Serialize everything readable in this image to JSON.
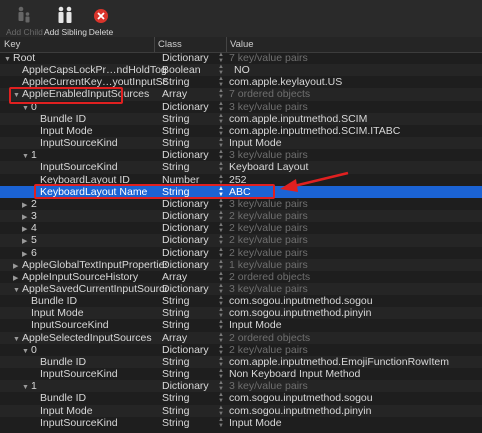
{
  "toolbar": {
    "add_child": "Add Child",
    "add_sibling": "Add Sibling",
    "delete": "Delete"
  },
  "columns": {
    "key": "Key",
    "class": "Class",
    "value": "Value"
  },
  "rows": [
    {
      "indent": 0,
      "tri": "down",
      "key": "Root",
      "type": "Dictionary",
      "value": "7 key/value pairs",
      "dim": true
    },
    {
      "indent": 1,
      "tri": "",
      "key": "AppleCapsLockPr…ndHoldToggleOff",
      "type": "Boolean",
      "value": "NO",
      "dim": false
    },
    {
      "indent": 1,
      "tri": "",
      "key": "AppleCurrentKey…youtInputSourceID",
      "type": "String",
      "value": "com.apple.keylayout.US",
      "dim": false
    },
    {
      "indent": 1,
      "tri": "down",
      "key": "AppleEnabledInputSources",
      "type": "Array",
      "value": "7 ordered objects",
      "dim": true
    },
    {
      "indent": 2,
      "tri": "down",
      "key": "0",
      "type": "Dictionary",
      "value": "3 key/value pairs",
      "dim": true
    },
    {
      "indent": 3,
      "tri": "",
      "key": "Bundle ID",
      "type": "String",
      "value": "com.apple.inputmethod.SCIM",
      "dim": false
    },
    {
      "indent": 3,
      "tri": "",
      "key": "Input Mode",
      "type": "String",
      "value": "com.apple.inputmethod.SCIM.ITABC",
      "dim": false
    },
    {
      "indent": 3,
      "tri": "",
      "key": "InputSourceKind",
      "type": "String",
      "value": "Input Mode",
      "dim": false
    },
    {
      "indent": 2,
      "tri": "down",
      "key": "1",
      "type": "Dictionary",
      "value": "3 key/value pairs",
      "dim": true
    },
    {
      "indent": 3,
      "tri": "",
      "key": "InputSourceKind",
      "type": "String",
      "value": "Keyboard Layout",
      "dim": false
    },
    {
      "indent": 3,
      "tri": "",
      "key": "KeyboardLayout ID",
      "type": "Number",
      "value": "252",
      "dim": false
    },
    {
      "indent": 3,
      "tri": "",
      "key": "KeyboardLayout Name",
      "type": "String",
      "value": "ABC",
      "dim": false,
      "selected": true
    },
    {
      "indent": 2,
      "tri": "right",
      "key": "2",
      "type": "Dictionary",
      "value": "3 key/value pairs",
      "dim": true
    },
    {
      "indent": 2,
      "tri": "right",
      "key": "3",
      "type": "Dictionary",
      "value": "2 key/value pairs",
      "dim": true
    },
    {
      "indent": 2,
      "tri": "right",
      "key": "4",
      "type": "Dictionary",
      "value": "2 key/value pairs",
      "dim": true
    },
    {
      "indent": 2,
      "tri": "right",
      "key": "5",
      "type": "Dictionary",
      "value": "2 key/value pairs",
      "dim": true
    },
    {
      "indent": 2,
      "tri": "right",
      "key": "6",
      "type": "Dictionary",
      "value": "2 key/value pairs",
      "dim": true
    },
    {
      "indent": 1,
      "tri": "right",
      "key": "AppleGlobalTextInputProperties",
      "type": "Dictionary",
      "value": "1 key/value pairs",
      "dim": true
    },
    {
      "indent": 1,
      "tri": "right",
      "key": "AppleInputSourceHistory",
      "type": "Array",
      "value": "2 ordered objects",
      "dim": true
    },
    {
      "indent": 1,
      "tri": "down",
      "key": "AppleSavedCurrentInputSource",
      "type": "Dictionary",
      "value": "3 key/value pairs",
      "dim": true
    },
    {
      "indent": 2,
      "tri": "",
      "key": "Bundle ID",
      "type": "String",
      "value": "com.sogou.inputmethod.sogou",
      "dim": false
    },
    {
      "indent": 2,
      "tri": "",
      "key": "Input Mode",
      "type": "String",
      "value": "com.sogou.inputmethod.pinyin",
      "dim": false
    },
    {
      "indent": 2,
      "tri": "",
      "key": "InputSourceKind",
      "type": "String",
      "value": "Input Mode",
      "dim": false
    },
    {
      "indent": 1,
      "tri": "down",
      "key": "AppleSelectedInputSources",
      "type": "Array",
      "value": "2 ordered objects",
      "dim": true
    },
    {
      "indent": 2,
      "tri": "down",
      "key": "0",
      "type": "Dictionary",
      "value": "2 key/value pairs",
      "dim": true
    },
    {
      "indent": 3,
      "tri": "",
      "key": "Bundle ID",
      "type": "String",
      "value": "com.apple.inputmethod.EmojiFunctionRowItem",
      "dim": false
    },
    {
      "indent": 3,
      "tri": "",
      "key": "InputSourceKind",
      "type": "String",
      "value": "Non Keyboard Input Method",
      "dim": false
    },
    {
      "indent": 2,
      "tri": "down",
      "key": "1",
      "type": "Dictionary",
      "value": "3 key/value pairs",
      "dim": true
    },
    {
      "indent": 3,
      "tri": "",
      "key": "Bundle ID",
      "type": "String",
      "value": "com.sogou.inputmethod.sogou",
      "dim": false
    },
    {
      "indent": 3,
      "tri": "",
      "key": "Input Mode",
      "type": "String",
      "value": "com.sogou.inputmethod.pinyin",
      "dim": false
    },
    {
      "indent": 3,
      "tri": "",
      "key": "InputSourceKind",
      "type": "String",
      "value": "Input Mode",
      "dim": false
    }
  ],
  "colors": {
    "selection": "#1b63d4",
    "annotation": "#e02020",
    "delete_icon": "#d9342b"
  },
  "icons": [
    "add-child-icon",
    "add-sibling-icon",
    "delete-icon",
    "disclosure-triangle-icon",
    "stepper-icon"
  ]
}
